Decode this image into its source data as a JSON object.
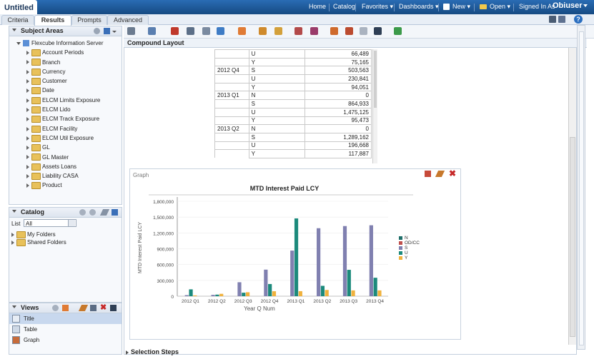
{
  "app": {
    "title": "Untitled",
    "user": "Obiuser"
  },
  "topnav": {
    "home": "Home",
    "catalog": "Catalog",
    "favorites": "Favorites ▾",
    "dashboards": "Dashboards ▾",
    "new": "New ▾",
    "open": "Open ▾",
    "signed_in_as": "Signed In As"
  },
  "tabs": [
    "Criteria",
    "Results",
    "Prompts",
    "Advanced"
  ],
  "subject_areas": {
    "title": "Subject Areas",
    "root": "Flexcube Information Server",
    "items": [
      "Account Periods",
      "Branch",
      "Currency",
      "Customer",
      "Date",
      "ELCM Limits Exposure",
      "ELCM Lido",
      "ELCM Track Exposure",
      "ELCM Facility",
      "ELCM Util Exposure",
      "GL",
      "GL Master",
      "Assets Loans",
      "Liability CASA",
      "Product"
    ]
  },
  "catalog": {
    "title": "Catalog",
    "list_label": "List",
    "list_value": "All",
    "folders": [
      "My Folders",
      "Shared Folders"
    ]
  },
  "views": {
    "title": "Views",
    "items": [
      "Title",
      "Table",
      "Graph"
    ]
  },
  "compound_layout": "Compound Layout",
  "pivot_rows": [
    {
      "q": "",
      "c": "U",
      "v": "66,489"
    },
    {
      "q": "",
      "c": "Y",
      "v": "75,165"
    },
    {
      "q": "2012 Q4",
      "c": "S",
      "v": "503,563"
    },
    {
      "q": "",
      "c": "U",
      "v": "230,841"
    },
    {
      "q": "",
      "c": "Y",
      "v": "94,051"
    },
    {
      "q": "2013 Q1",
      "c": "N",
      "v": "0"
    },
    {
      "q": "",
      "c": "S",
      "v": "864,933"
    },
    {
      "q": "",
      "c": "U",
      "v": "1,475,125"
    },
    {
      "q": "",
      "c": "Y",
      "v": "95,473"
    },
    {
      "q": "2013 Q2",
      "c": "N",
      "v": "0"
    },
    {
      "q": "",
      "c": "S",
      "v": "1,289,162"
    },
    {
      "q": "",
      "c": "U",
      "v": "196,668"
    },
    {
      "q": "",
      "c": "Y",
      "v": "117,887"
    }
  ],
  "graph_label": "Graph",
  "selection_steps": "Selection Steps",
  "chart_data": {
    "type": "bar",
    "title": "MTD Interest Paid LCY",
    "xlabel": "Year Q Num",
    "ylabel": "MTD Interest Paid LCY",
    "ylim": [
      0,
      1800000
    ],
    "yticks": [
      "1,800,000",
      "1,500,000",
      "1,200,000",
      "900,000",
      "600,000",
      "300,000",
      "0"
    ],
    "categories": [
      "2012 Q1",
      "2012 Q2",
      "2012 Q3",
      "2012 Q4",
      "2013 Q1",
      "2013 Q2",
      "2013 Q3",
      "2013 Q4"
    ],
    "series": [
      {
        "name": "N",
        "color": "#1f6f6a",
        "values": [
          0,
          0,
          0,
          0,
          0,
          0,
          0,
          0
        ]
      },
      {
        "name": "OD/CC",
        "color": "#c0504d",
        "values": [
          0,
          0,
          0,
          0,
          0,
          0,
          0,
          0
        ]
      },
      {
        "name": "S",
        "color": "#8080b0",
        "values": [
          20000,
          25000,
          265000,
          503563,
          864933,
          1289162,
          1330000,
          1345000
        ]
      },
      {
        "name": "U",
        "color": "#1c8a7c",
        "values": [
          130000,
          30000,
          66489,
          230841,
          1475125,
          196668,
          500000,
          350000
        ]
      },
      {
        "name": "Y",
        "color": "#f0b23e",
        "values": [
          15000,
          45000,
          75165,
          94051,
          95473,
          117887,
          110000,
          110000
        ]
      }
    ],
    "legend": "right"
  }
}
